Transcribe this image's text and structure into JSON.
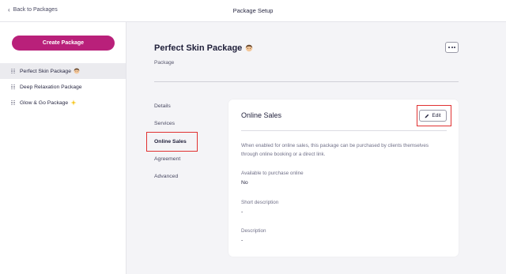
{
  "topbar": {
    "back_label": "Back to Packages",
    "title": "Package Setup"
  },
  "sidebar": {
    "create_label": "Create Package",
    "packages": [
      {
        "name": "Perfect Skin Package",
        "emoji": "face-icon",
        "selected": true
      },
      {
        "name": "Deep Relaxation Package",
        "emoji": "",
        "selected": false
      },
      {
        "name": "Glow & Go Package",
        "emoji": "sparkles-icon",
        "selected": false
      }
    ]
  },
  "header": {
    "title": "Perfect Skin Package",
    "subtitle": "Package",
    "more_icon": "more-dots-icon"
  },
  "subnav": {
    "items": [
      "Details",
      "Services",
      "Online Sales",
      "Agreement",
      "Advanced"
    ],
    "active": "Online Sales"
  },
  "card": {
    "title": "Online Sales",
    "edit_label": "Edit",
    "description": "When enabled for online sales, this package can be purchased by clients themselves through online booking or a direct link.",
    "fields": [
      {
        "label": "Available to purchase online",
        "value": "No"
      },
      {
        "label": "Short description",
        "value": "-"
      },
      {
        "label": "Description",
        "value": "-"
      }
    ]
  },
  "colors": {
    "brand": "#b9207a",
    "highlight": "#e03131"
  }
}
